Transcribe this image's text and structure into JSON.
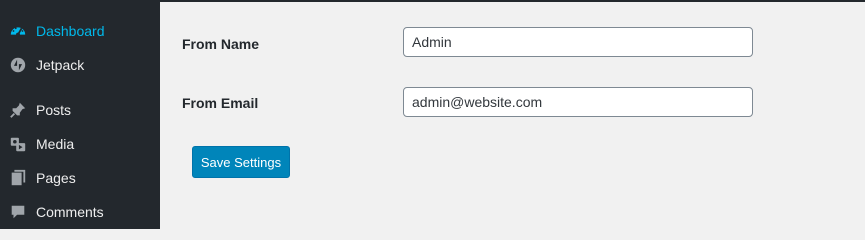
{
  "sidebar": {
    "items": [
      {
        "label": "Dashboard",
        "icon": "dashboard-icon",
        "current": true
      },
      {
        "label": "Jetpack",
        "icon": "jetpack-icon"
      },
      {
        "label": "Posts",
        "icon": "pushpin-icon"
      },
      {
        "label": "Media",
        "icon": "media-icon"
      },
      {
        "label": "Pages",
        "icon": "pages-icon"
      },
      {
        "label": "Comments",
        "icon": "comment-icon"
      }
    ]
  },
  "form": {
    "from_name_label": "From Name",
    "from_name_value": "Admin",
    "from_email_label": "From Email",
    "from_email_value": "admin@website.com",
    "save_label": "Save Settings"
  },
  "colors": {
    "sidebar_bg": "#23282d",
    "menu_text": "#eeeeee",
    "menu_current": "#00b9eb",
    "content_bg": "#f1f1f1",
    "button_bg": "#0085ba"
  }
}
